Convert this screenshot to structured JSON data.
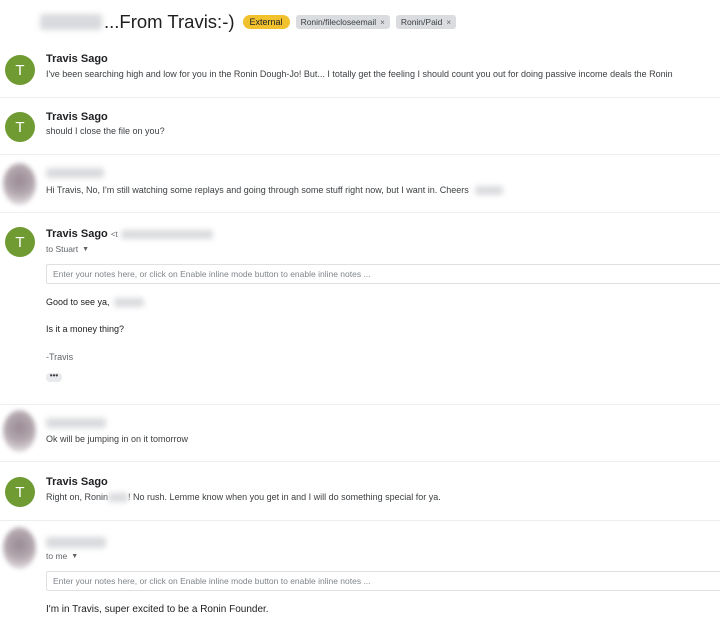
{
  "subject": {
    "text": "...From Travis:-)",
    "labels": {
      "external": "External",
      "filecloseemail": "Ronin/filecloseemail",
      "paid": "Ronin/Paid",
      "remove_glyph": "×"
    }
  },
  "messages": [
    {
      "avatar_letter": "T",
      "sender": "Travis Sago",
      "snippet": "I've been searching high and low for you in the Ronin Dough-Jo! But... I totally get the feeling I should count you out for doing passive income deals the Ronin"
    },
    {
      "avatar_letter": "T",
      "sender": "Travis Sago",
      "snippet": "should I close the file on you?"
    },
    {
      "snippet": "Hi Travis, No, I'm still watching some replays and going through some stuff right now, but I want in. Cheers"
    },
    {
      "avatar_letter": "T",
      "sender": "Travis Sago",
      "email_prefix": "<t",
      "to": "to Stuart",
      "notes_placeholder": "Enter your notes here, or click on Enable inline mode button to enable inline notes ...",
      "body": [
        "Good to see ya,",
        "Is it a money thing?",
        "-Travis"
      ],
      "more_glyph": "•••"
    },
    {
      "snippet": "Ok will be jumping in on it tomorrow"
    },
    {
      "avatar_letter": "T",
      "sender": "Travis Sago",
      "snippet_a": "Right on, Ronin",
      "snippet_b": "! No rush. Lemme know when you get in and I will do something special for ya."
    },
    {
      "to": "to me",
      "notes_placeholder": "Enter your notes here, or click on Enable inline mode button to enable inline notes ...",
      "body": "I'm in Travis, super excited to be a Ronin Founder."
    }
  ],
  "colors": {
    "avatar_green": "#6f9b32",
    "external_label": "#f2c12e"
  }
}
